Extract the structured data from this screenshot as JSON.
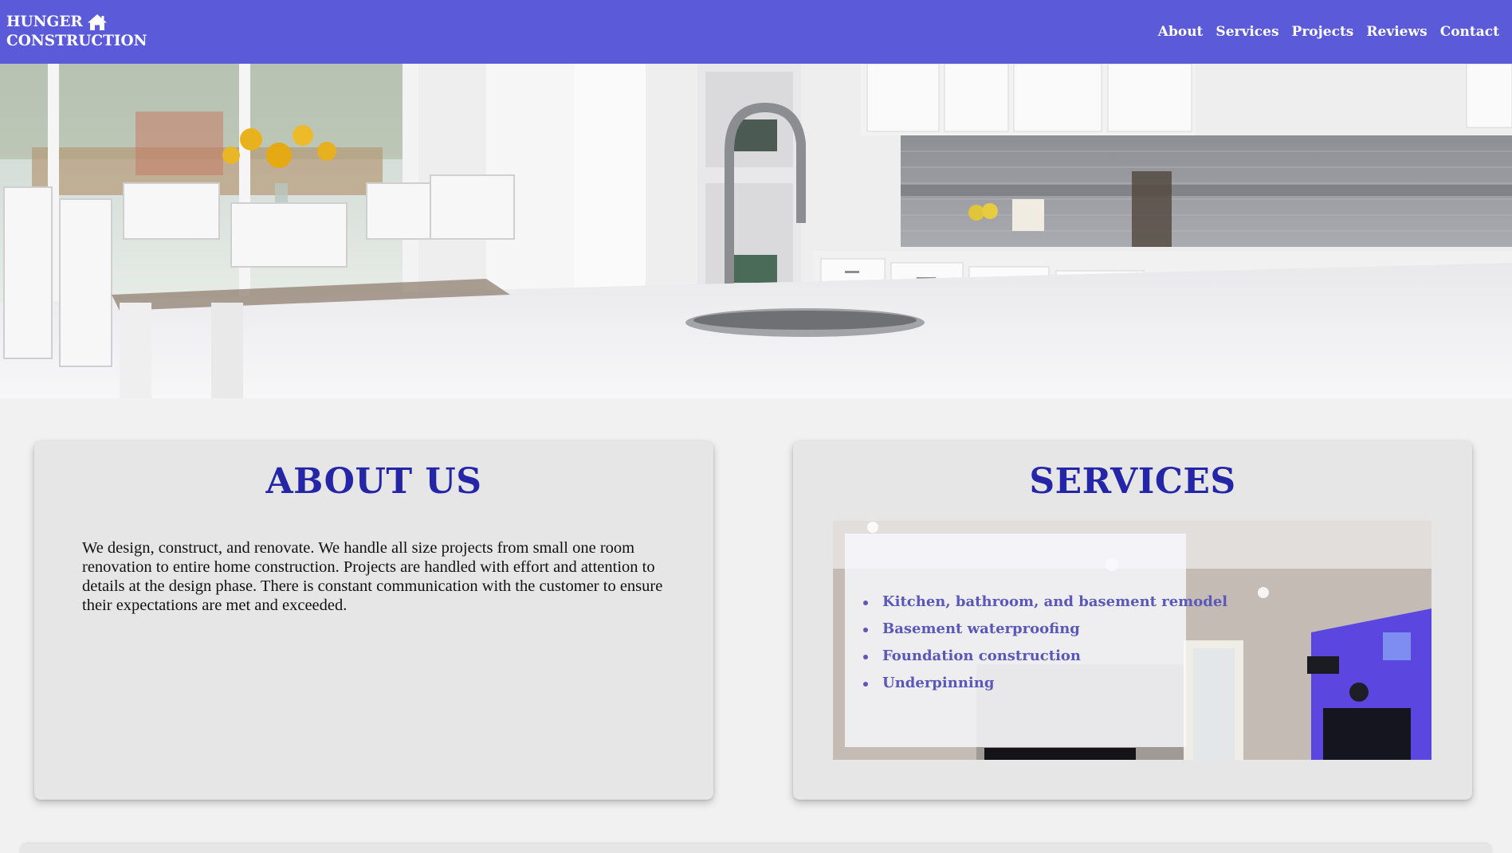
{
  "brand": {
    "line1": "HUNGER",
    "line2": "CONSTRUCTION"
  },
  "nav": {
    "links": [
      "About",
      "Services",
      "Projects",
      "Reviews",
      "Contact"
    ]
  },
  "hero": {
    "icon": "kitchen-photo"
  },
  "about": {
    "title": "ABOUT US",
    "text": "We design, construct, and renovate. We handle all size projects from small one room renovation to entire home construction. Projects are handled with effort and attention to details at the design phase. There is constant communication with the customer to ensure their expectations are met and exceeded."
  },
  "services": {
    "title": "SERVICES",
    "items": [
      "Kitchen, bathroom, and basement remodel",
      "Basement waterproofing",
      "Foundation construction",
      "Underpinning"
    ]
  },
  "colors": {
    "navbar": "#5b5bd9",
    "heading": "#2525a8",
    "services_text": "#5a58b8",
    "page_bg": "#f1f1f1",
    "card_bg": "#e6e6e6"
  }
}
